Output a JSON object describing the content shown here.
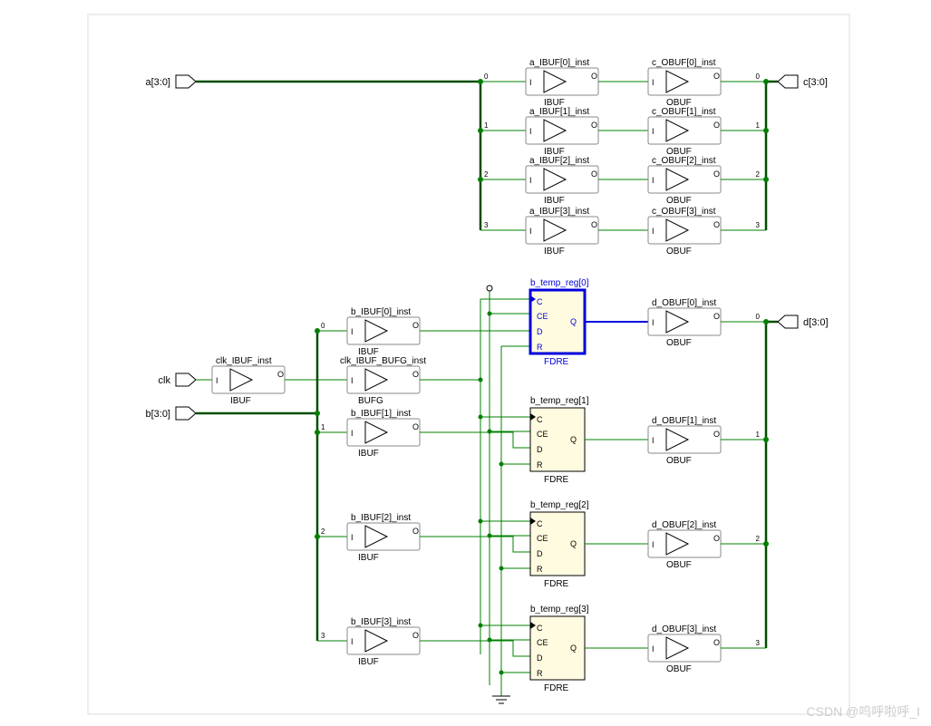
{
  "ports": {
    "a": "a[3:0]",
    "clk": "clk",
    "b": "b[3:0]",
    "c": "c[3:0]",
    "d": "d[3:0]"
  },
  "buffers": {
    "a_ibuf": [
      "a_IBUF[0]_inst",
      "a_IBUF[1]_inst",
      "a_IBUF[2]_inst",
      "a_IBUF[3]_inst"
    ],
    "c_obuf": [
      "c_OBUF[0]_inst",
      "c_OBUF[1]_inst",
      "c_OBUF[2]_inst",
      "c_OBUF[3]_inst"
    ],
    "b_ibuf": [
      "b_IBUF[0]_inst",
      "b_IBUF[1]_inst",
      "b_IBUF[2]_inst",
      "b_IBUF[3]_inst"
    ],
    "d_obuf": [
      "d_OBUF[0]_inst",
      "d_OBUF[1]_inst",
      "d_OBUF[2]_inst",
      "d_OBUF[3]_inst"
    ],
    "clk_ibuf": "clk_IBUF_inst",
    "clk_bufg": "clk_IBUF_BUFG_inst"
  },
  "regs": [
    "b_temp_reg[0]",
    "b_temp_reg[1]",
    "b_temp_reg[2]",
    "b_temp_reg[3]"
  ],
  "types": {
    "ibuf": "IBUF",
    "obuf": "OBUF",
    "bufg": "BUFG",
    "fdre": "FDRE"
  },
  "pins": {
    "I": "I",
    "O": "O",
    "C": "C",
    "CE": "CE",
    "D": "D",
    "R": "R",
    "Q": "Q"
  },
  "bits": [
    "0",
    "1",
    "2",
    "3"
  ],
  "watermark": "CSDN @呜呼啦呼_I"
}
